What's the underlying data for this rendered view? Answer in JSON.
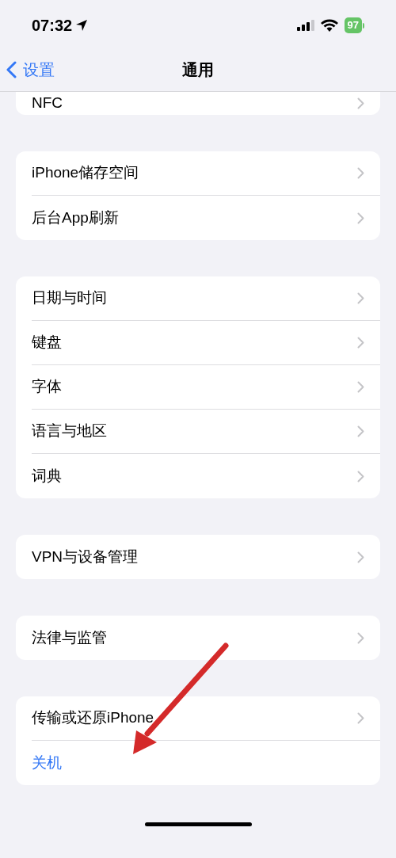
{
  "status_bar": {
    "time": "07:32",
    "battery": "97"
  },
  "nav": {
    "back": "设置",
    "title": "通用"
  },
  "groups": [
    {
      "cut": true,
      "items": [
        {
          "label": "NFC",
          "kind": "nav"
        }
      ]
    },
    {
      "cut": false,
      "items": [
        {
          "label": "iPhone储存空间",
          "kind": "nav"
        },
        {
          "label": "后台App刷新",
          "kind": "nav"
        }
      ]
    },
    {
      "cut": false,
      "items": [
        {
          "label": "日期与时间",
          "kind": "nav"
        },
        {
          "label": "键盘",
          "kind": "nav"
        },
        {
          "label": "字体",
          "kind": "nav"
        },
        {
          "label": "语言与地区",
          "kind": "nav"
        },
        {
          "label": "词典",
          "kind": "nav"
        }
      ]
    },
    {
      "cut": false,
      "items": [
        {
          "label": "VPN与设备管理",
          "kind": "nav"
        }
      ]
    },
    {
      "cut": false,
      "items": [
        {
          "label": "法律与监管",
          "kind": "nav"
        }
      ]
    },
    {
      "cut": false,
      "items": [
        {
          "label": "传输或还原iPhone",
          "kind": "nav"
        },
        {
          "label": "关机",
          "kind": "action"
        }
      ]
    }
  ]
}
